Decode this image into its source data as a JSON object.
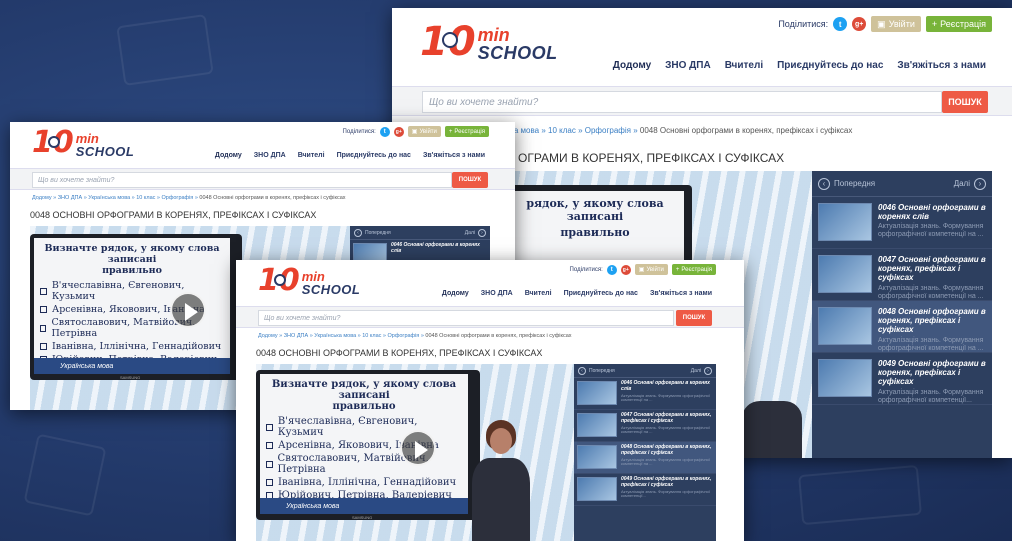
{
  "site": {
    "logo_ten": "10",
    "logo_min": "min",
    "logo_school": "SCHOOL",
    "share_label": "Поділитися:",
    "twitter_glyph": "t",
    "gplus_glyph": "g+",
    "login_label": "Увійти",
    "register_label": "Реєстрація",
    "nav": [
      "Додому",
      "ЗНО ДПА",
      "Вчителі",
      "Приєднуйтесь до нас",
      "Зв'яжіться з нами"
    ],
    "search_placeholder": "Що ви хочете знайти?",
    "search_button": "ПОШУК"
  },
  "breadcrumb_full": {
    "items": [
      "Додому",
      "ЗНО ДПА",
      "Українська мова",
      "10 клас",
      "Орфографія"
    ],
    "separator": "»",
    "current": "0048 Основні орфограми в коренях, префіксах і суфіксах"
  },
  "breadcrumb_big_visible": {
    "items": [
      "ська мова",
      "10 клас",
      "Орфографія"
    ],
    "separator": "»",
    "current": "0048 Основні орфограми в коренях, префіксах і суфіксах"
  },
  "page_title": "0048 ОСНОВНІ ОРФОГРАМИ В КОРЕНЯХ, ПРЕФІКСАХ І СУФІКСАХ",
  "page_title_big_visible": "ОГРАМИ В КОРЕНЯХ, ПРЕФІКСАХ І СУФІКСАХ",
  "board": {
    "question_line1": "Визначте рядок, у якому слова записані",
    "question_line2": "правильно",
    "options": [
      "В'ячеславівна, Євгенович, Кузьмич",
      "Арсенівна, Яковович, Іванівна",
      "Святославович, Матвійович, Петрівна",
      "Іванівна, Іллінічна, Геннадійович",
      "Юрійович, Петрівна, Валеріевич"
    ],
    "subject": "Українська мова",
    "brand": "SAMSUNG",
    "big_q1": "рядок, у якому слова записані",
    "big_q2": "правильно"
  },
  "playlist": {
    "prev": "Попередня",
    "next": "Далі",
    "items": [
      {
        "title": "0046 Основні орфограми в коренях слів",
        "desc": "Актуалізація знань. Формування орфографічної компетенції на ..."
      },
      {
        "title": "0047 Основні орфограми в коренях, префіксах і суфіксах",
        "desc": "Актуалізація знань. Формування орфографічної компетенції на ..."
      },
      {
        "title": "0048 Основні орфограми в коренях, префіксах і суфіксах",
        "desc": "Актуалізація знань. Формування орфографічної компетенції на ..."
      },
      {
        "title": "0049 Основні орфограми в коренях, префіксах і суфіксах",
        "desc": "Актуалізація знань. Формування орфографічної компетенції..."
      }
    ]
  },
  "colors": {
    "background": "#233a6b",
    "brand_red": "#e8412c",
    "brand_navy": "#2a3a66",
    "search_button": "#ee5a45",
    "register_green": "#78b43a",
    "login_tan": "#cfc29a",
    "playlist_bg": "#2d3f5f"
  }
}
